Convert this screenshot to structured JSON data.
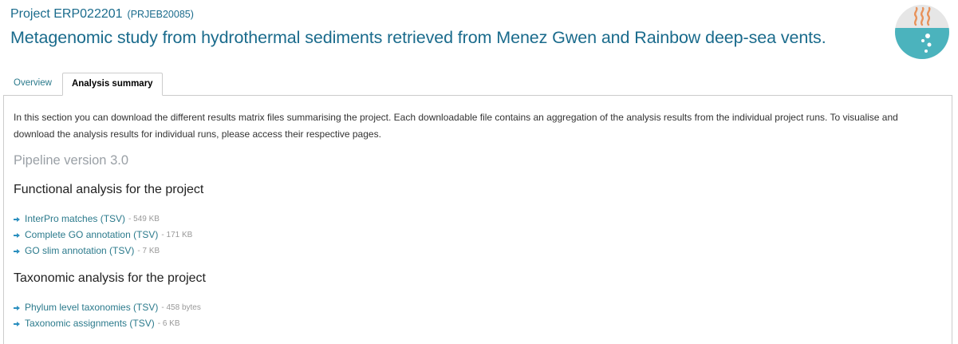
{
  "header": {
    "project_id": "Project ERP022201",
    "project_accession": "(PRJEB20085)",
    "title": "Metagenomic study from hydrothermal sediments retrieved from Menez Gwen and Rainbow deep-sea vents."
  },
  "biome_icon": "hydrothermal-vent-biome-icon",
  "tabs": [
    {
      "label": "Overview",
      "active": false
    },
    {
      "label": "Analysis summary",
      "active": true
    }
  ],
  "panel": {
    "intro": "In this section you can download the different results matrix files summarising the project. Each downloadable file contains an aggregation of the analysis results from the individual project runs. To visualise and download the analysis results for individual runs, please access their respective pages.",
    "pipeline_version": "Pipeline version 3.0",
    "functional": {
      "heading": "Functional analysis for the project",
      "files": [
        {
          "label": "InterPro matches (TSV)",
          "size": "- 549 KB"
        },
        {
          "label": "Complete GO annotation (TSV)",
          "size": "- 171 KB"
        },
        {
          "label": "GO slim annotation (TSV)",
          "size": "- 7 KB"
        }
      ]
    },
    "taxonomic": {
      "heading": "Taxonomic analysis for the project",
      "files": [
        {
          "label": "Phylum level taxonomies (TSV)",
          "size": "- 458 bytes"
        },
        {
          "label": "Taxonomic assignments (TSV)",
          "size": "- 6 KB"
        }
      ]
    }
  },
  "colors": {
    "link": "#2b7a8c",
    "title": "#1a6b8c",
    "icon_water": "#4bb3bd",
    "icon_steam": "#e8925a"
  }
}
